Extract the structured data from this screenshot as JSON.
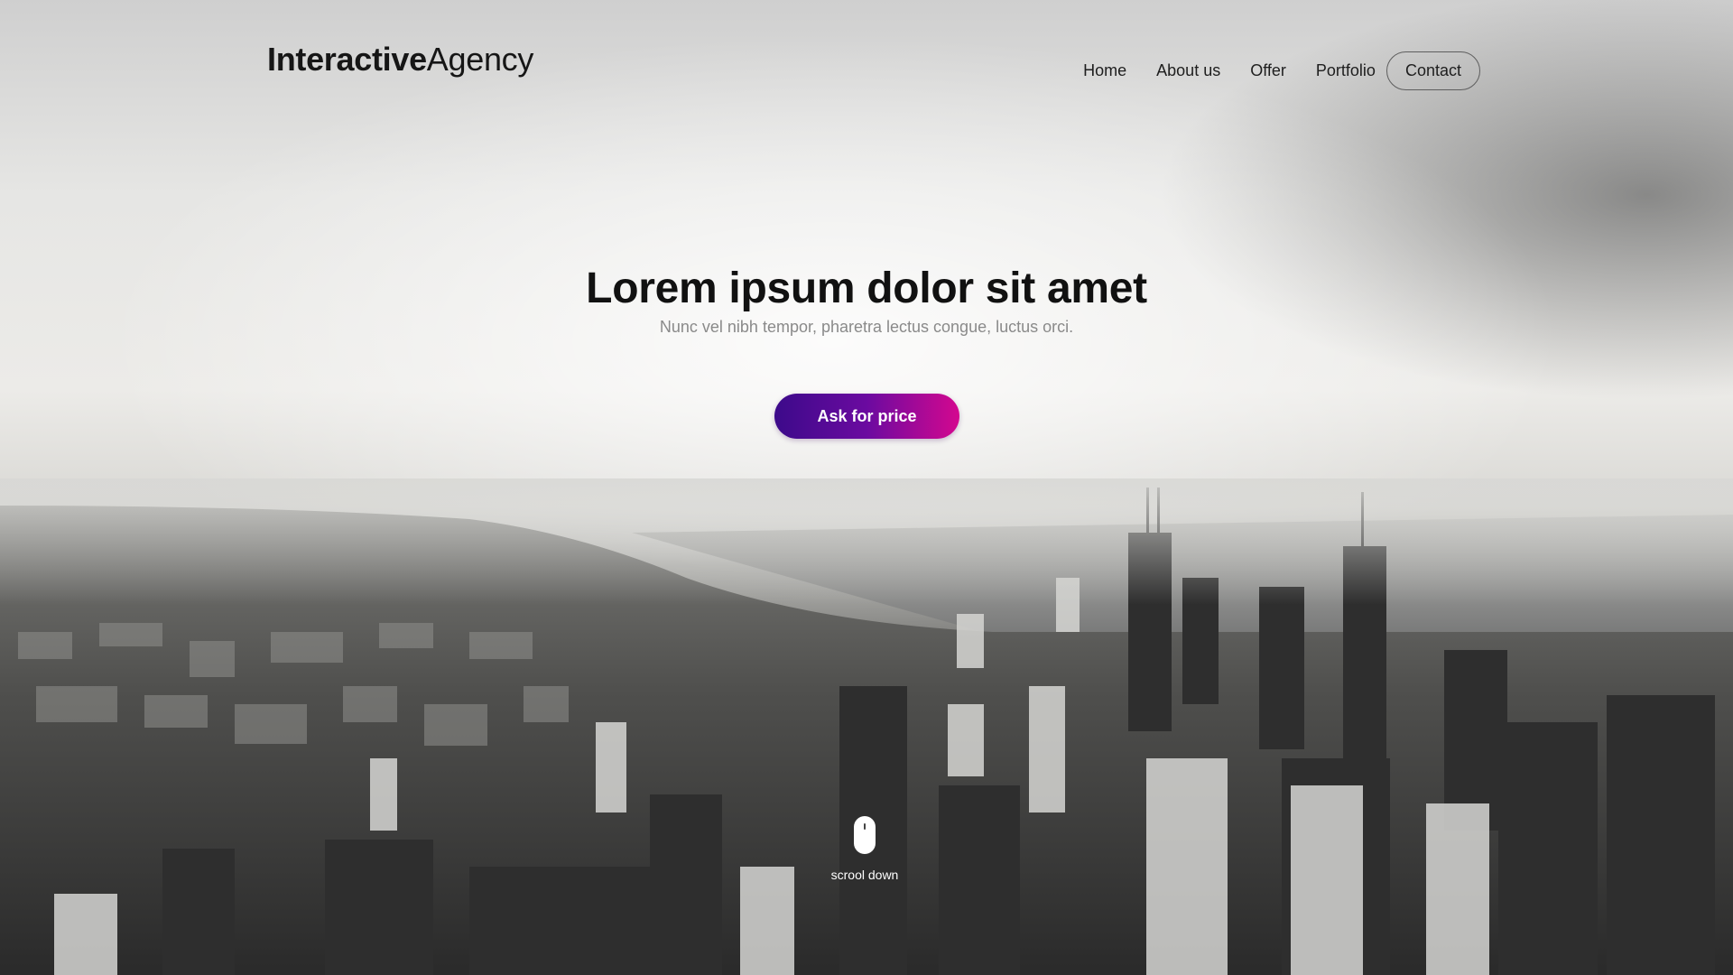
{
  "logo": {
    "strong": "Interactive",
    "light": "Agency"
  },
  "nav": {
    "items": [
      "Home",
      "About us",
      "Offer",
      "Portfolio"
    ],
    "contact": "Contact"
  },
  "hero": {
    "title": "Lorem ipsum dolor sit amet",
    "subtitle": "Nunc vel nibh tempor, pharetra lectus congue, luctus orci.",
    "cta": "Ask for price",
    "cta_gradient": [
      "#3c0a8a",
      "#d4088f"
    ]
  },
  "scroll": {
    "label": "scrool down",
    "icon": "mouse-icon"
  }
}
